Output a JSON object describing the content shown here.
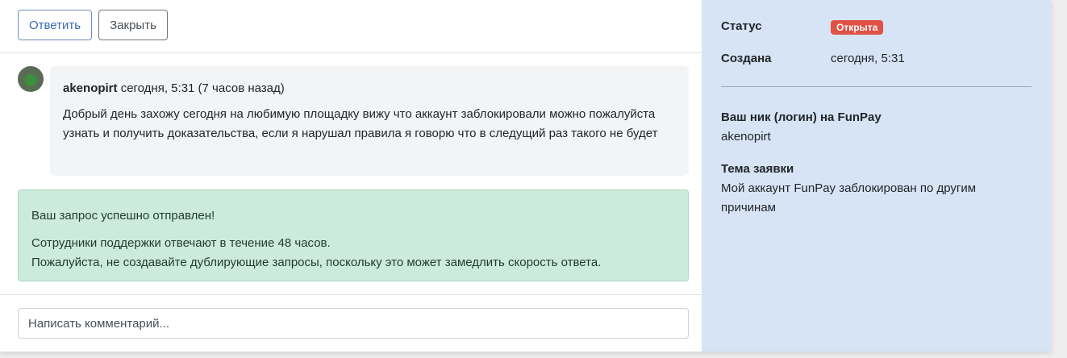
{
  "toolbar": {
    "reply_label": "Ответить",
    "close_label": "Закрыть"
  },
  "message": {
    "author": "akenopirt",
    "timestamp": "сегодня, 5:31 (7 часов назад)",
    "text": "Добрый день захожу сегодня на любимую площадку вижу что аккаунт заблокировали можно пожалуйста узнать и получить доказательства, если я нарушал правила я говорю что в следущий раз такого не будет"
  },
  "alert": {
    "title": "Ваш запрос успешно отправлен!",
    "line1": "Сотрудники поддержки отвечают в течение 48 часов.",
    "line2": "Пожалуйста, не создавайте дублирующие запросы, поскольку это может замедлить скорость ответа."
  },
  "comment": {
    "placeholder": "Написать комментарий..."
  },
  "sidebar": {
    "status_label": "Статус",
    "status_value": "Открыта",
    "created_label": "Создана",
    "created_value": "сегодня, 5:31",
    "fields": [
      {
        "label": "Ваш ник (логин) на FunPay",
        "value": "akenopirt"
      },
      {
        "label": "Тема заявки",
        "value": "Мой аккаунт FunPay заблокирован по другим причинам"
      }
    ]
  },
  "colors": {
    "sidebar_bg": "#d6e4f5",
    "status_badge": "#e05246",
    "alert_success_bg": "#cdebdd",
    "primary_outline": "#3a6cad"
  }
}
